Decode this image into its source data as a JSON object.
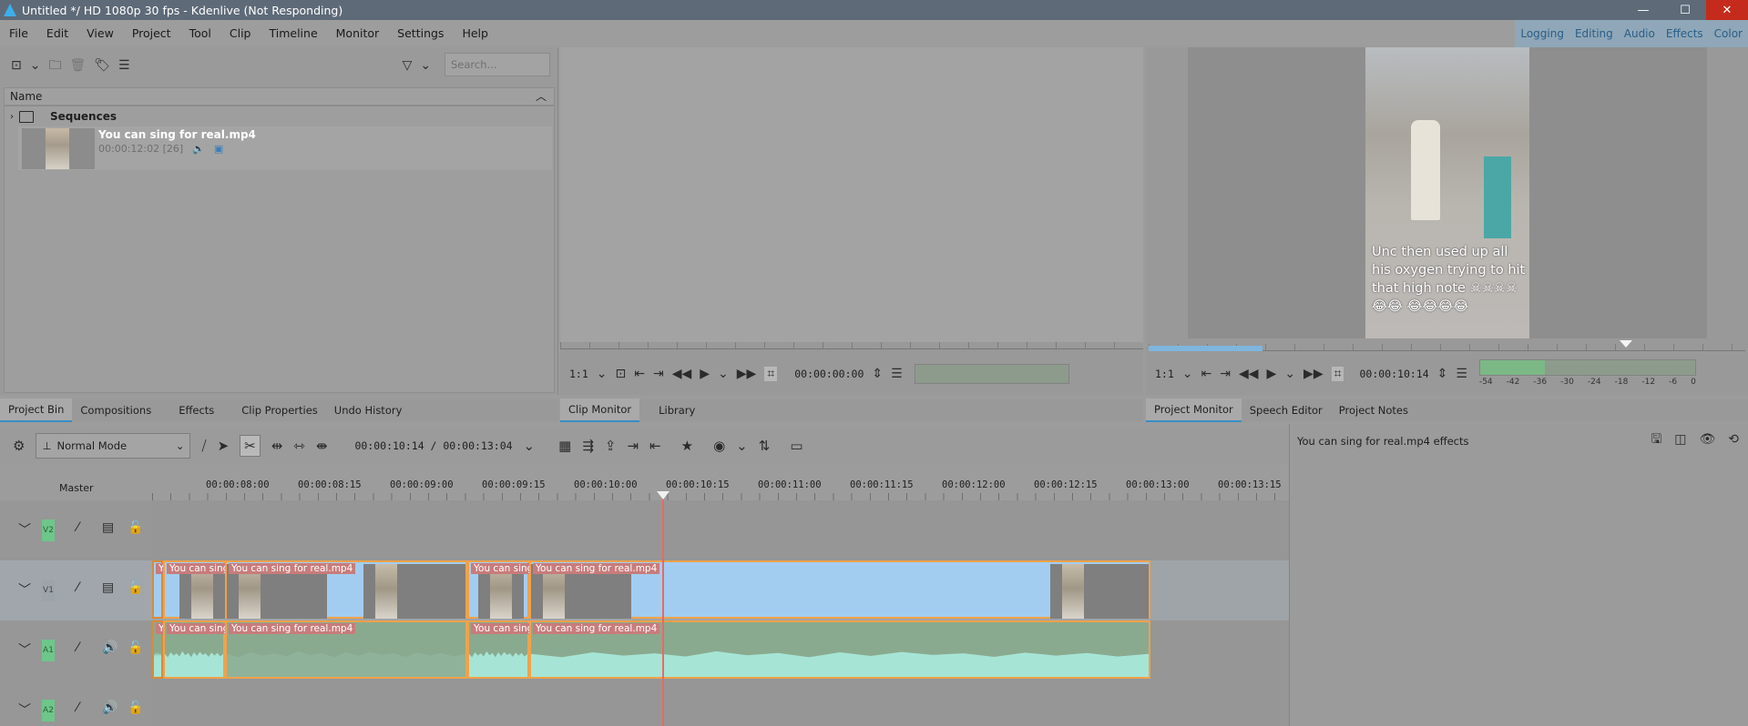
{
  "window": {
    "title": "Untitled */ HD 1080p 30 fps - Kdenlive (Not Responding)",
    "minimize": "—",
    "maximize": "☐",
    "close": "✕"
  },
  "menu": [
    "File",
    "Edit",
    "View",
    "Project",
    "Tool",
    "Clip",
    "Timeline",
    "Monitor",
    "Settings",
    "Help"
  ],
  "layouts": [
    "Logging",
    "Editing",
    "Audio",
    "Effects",
    "Color"
  ],
  "bin": {
    "search_placeholder": "Search...",
    "column": "Name",
    "folder": "Sequences",
    "clip": {
      "name": "You can sing for real.mp4",
      "duration": "00:00:12:02 [26]"
    }
  },
  "bin_tabs": [
    "Project Bin",
    "Compositions",
    "Effects",
    "Clip Properties",
    "Undo History"
  ],
  "clip_monitor": {
    "zoom": "1:1",
    "timecode": "00:00:00:00"
  },
  "clip_monitor_tabs": [
    "Clip Monitor",
    "Library"
  ],
  "project_monitor": {
    "zoom": "1:1",
    "timecode": "00:00:10:14",
    "caption": "Unc then used up all his oxygen trying to hit that high note ☠☠☠☠😂😂 😂😂😂😂",
    "vu_labels": [
      "-54",
      "-42",
      "-36",
      "-30",
      "-24",
      "-18",
      "-12",
      "-6",
      "0"
    ]
  },
  "project_monitor_tabs": [
    "Project Monitor",
    "Speech Editor",
    "Project Notes"
  ],
  "timeline": {
    "mode": "Normal Mode",
    "position": "00:00:10:14 / 00:00:13:04",
    "master": "Master",
    "ruler": [
      "00:00:08:00",
      "00:00:08:15",
      "00:00:09:00",
      "00:00:09:15",
      "00:00:10:00",
      "00:00:10:15",
      "00:00:11:00",
      "00:00:11:15",
      "00:00:12:00",
      "00:00:12:15",
      "00:00:13:00",
      "00:00:13:15"
    ],
    "tracks": [
      "V2",
      "V1",
      "A1",
      "A2"
    ],
    "clip_label_short": "You can sing",
    "clip_label": "You can sing for real.mp4",
    "clip_label_y": "Y"
  },
  "effects_panel": {
    "title": "You can sing for real.mp4 effects"
  }
}
